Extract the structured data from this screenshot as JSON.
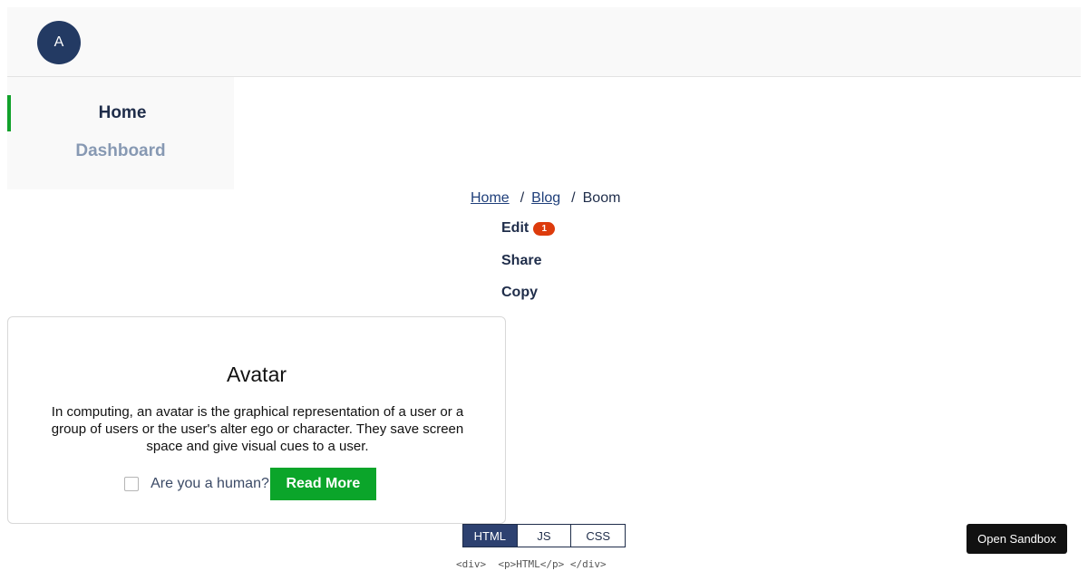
{
  "header": {
    "avatar_initial": "A"
  },
  "sidebar": {
    "items": [
      {
        "label": "Home",
        "active": true
      },
      {
        "label": "Dashboard",
        "active": false
      }
    ]
  },
  "breadcrumb": {
    "items": [
      "Home",
      "Blog",
      "Boom"
    ],
    "separator": "/"
  },
  "actions": {
    "items": [
      {
        "label": "Edit",
        "badge": "1"
      },
      {
        "label": "Share"
      },
      {
        "label": "Copy"
      }
    ]
  },
  "card": {
    "title": "Avatar",
    "body": "In computing, an avatar is the graphical representation of a user or a group of users or the user's alter ego or character. They save screen space and give visual cues to a user.",
    "checkbox_label": "Are you a human?",
    "checkbox_checked": false,
    "button_label": "Read More"
  },
  "code_tabs": {
    "tabs": [
      "HTML",
      "JS",
      "CSS"
    ],
    "active": "HTML",
    "preview": "<div>  <p>HTML</p> </div>"
  },
  "sandbox_button": "Open Sandbox",
  "colors": {
    "accent_green": "#0ba52a",
    "avatar_bg": "#233a63",
    "badge_red": "#dd3b0c",
    "active_tab": "#2d4170"
  }
}
